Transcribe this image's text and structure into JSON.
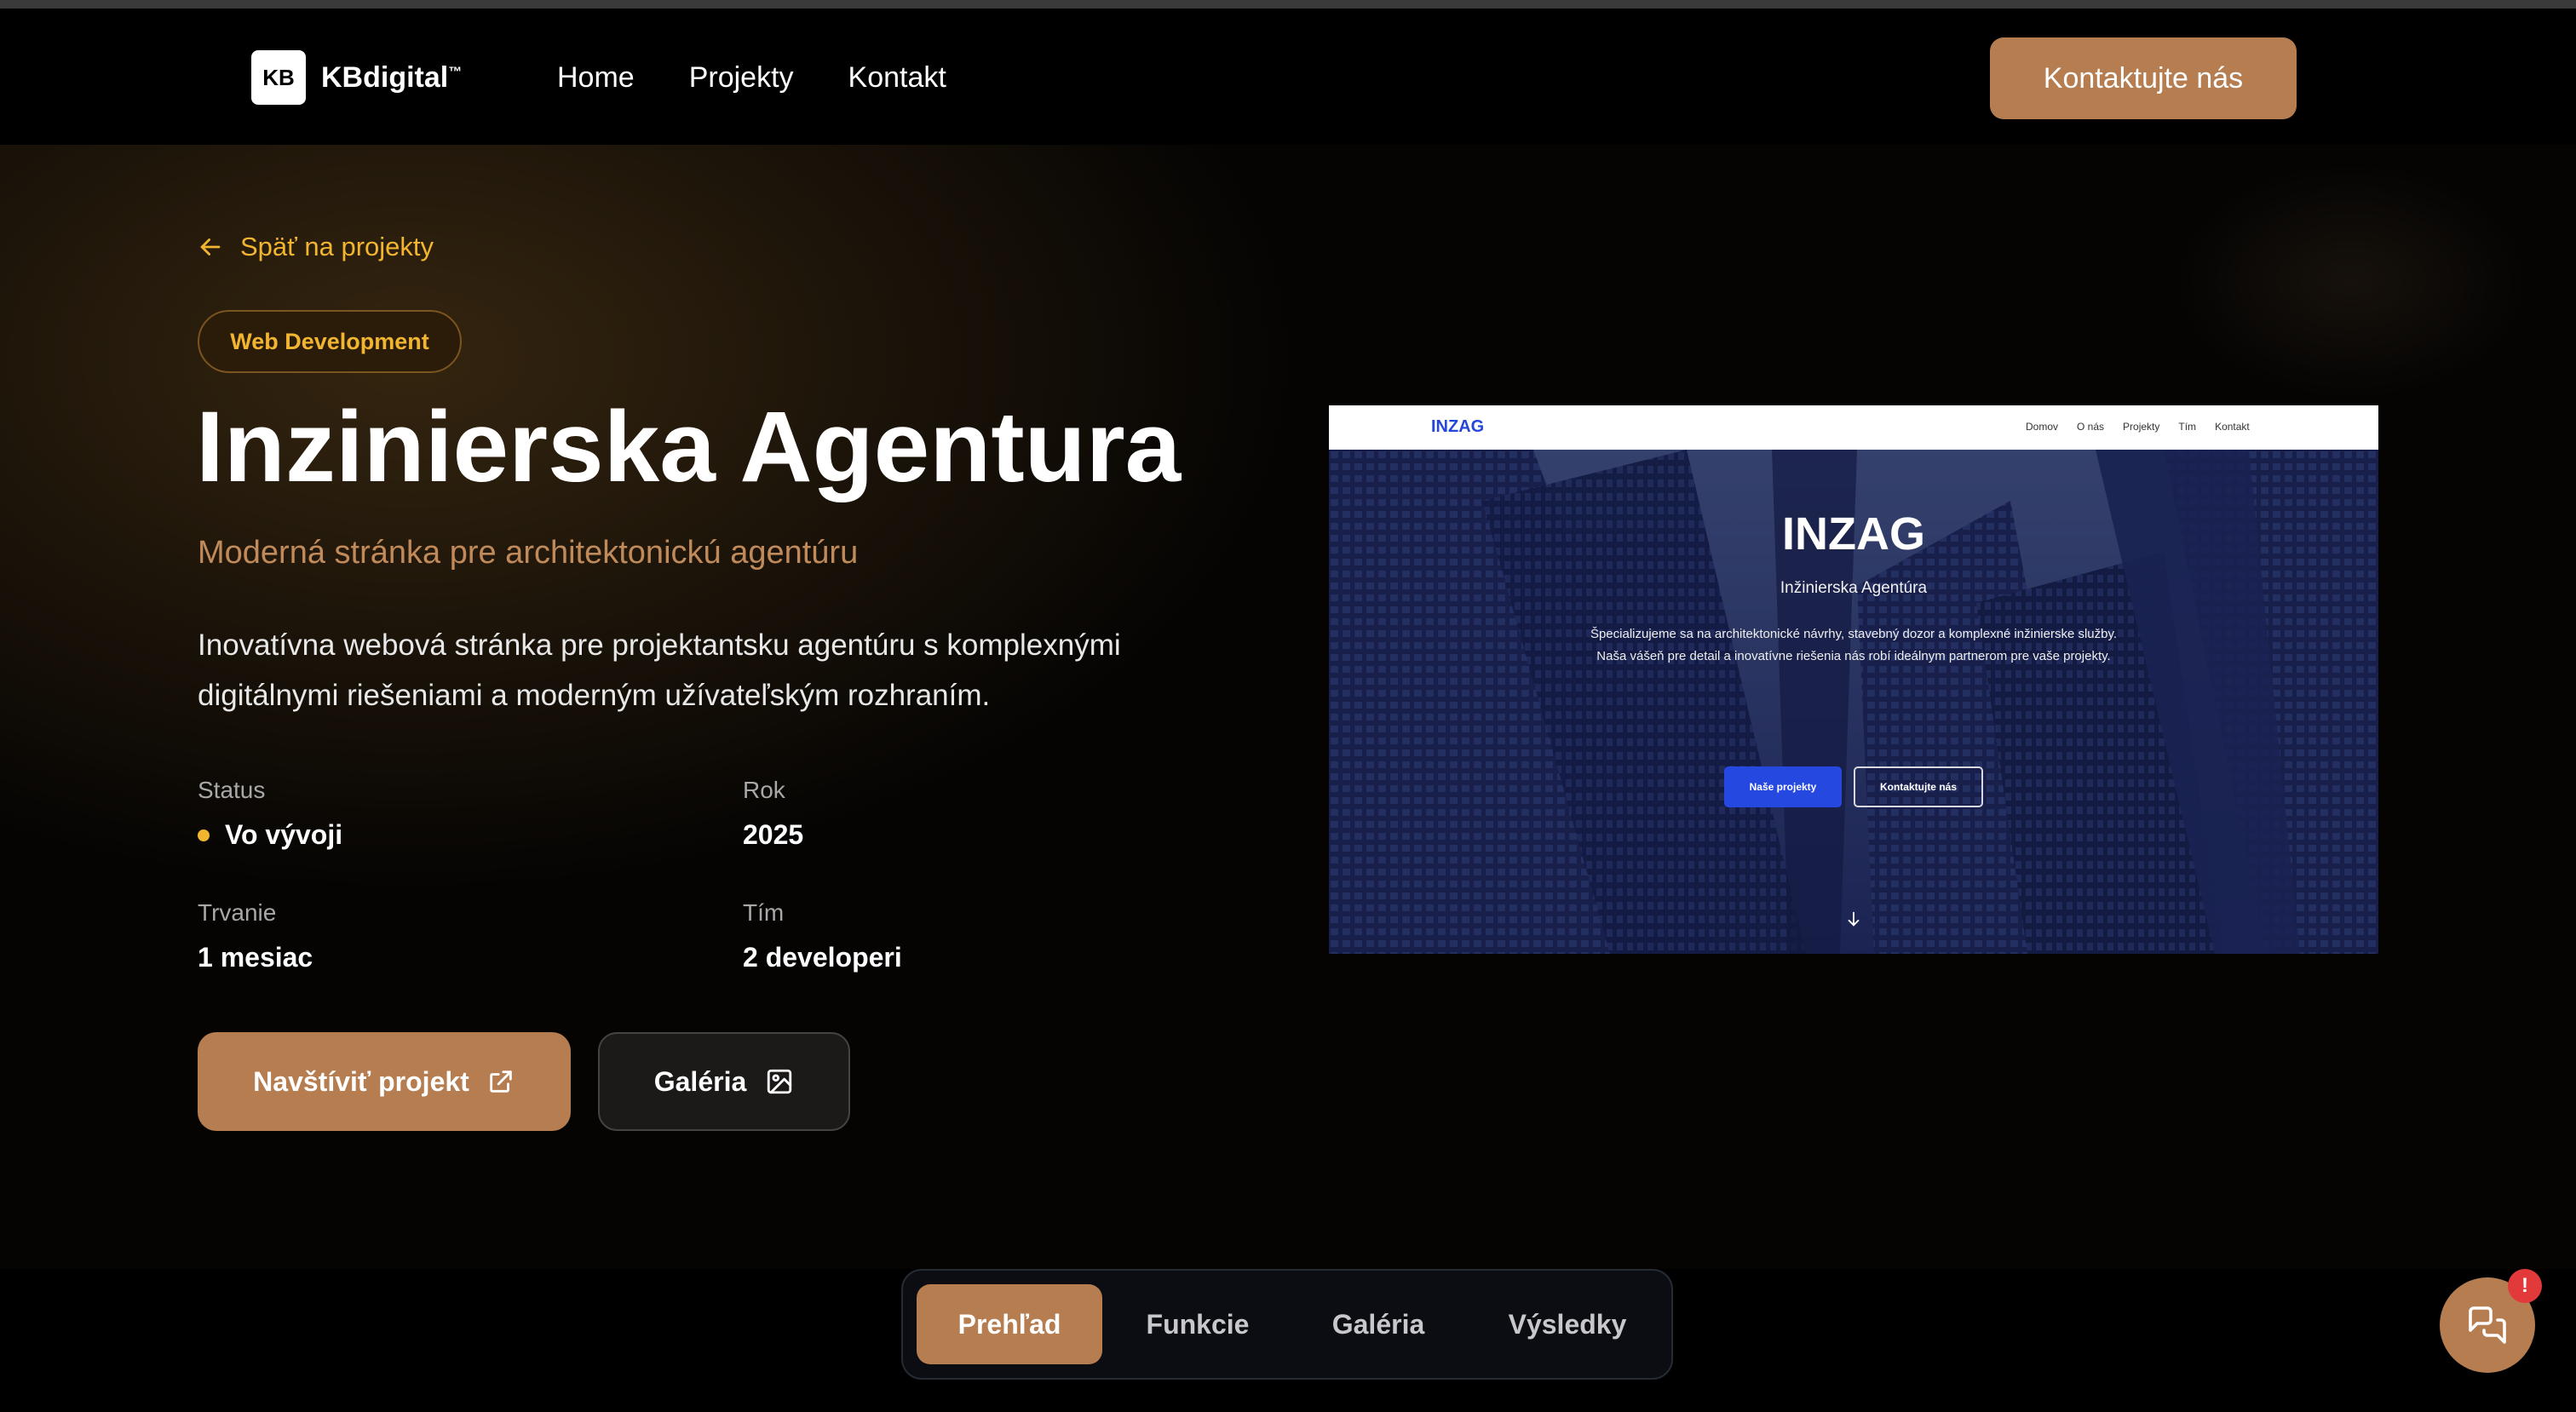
{
  "header": {
    "logo_mark": "KB",
    "logo_text": "KBdigital",
    "logo_tm": "™",
    "nav": [
      {
        "label": "Home"
      },
      {
        "label": "Projekty"
      },
      {
        "label": "Kontakt"
      }
    ],
    "cta_label": "Kontaktujte nás"
  },
  "project": {
    "back_label": "Späť na projekty",
    "category": "Web Development",
    "title": "Inzinierska Agentura",
    "subtitle": "Moderná stránka pre architektonickú agentúru",
    "description": "Inovatívna webová stránka pre projektantsku agentúru s komplexnými digitálnymi riešeniami a moderným užívateľským rozhraním.",
    "meta": {
      "status_label": "Status",
      "status_value": "Vo vývoji",
      "status_color": "#f2b530",
      "year_label": "Rok",
      "year_value": "2025",
      "duration_label": "Trvanie",
      "duration_value": "1 mesiac",
      "team_label": "Tím",
      "team_value": "2 developeri"
    },
    "visit_label": "Navštíviť projekt",
    "gallery_label": "Galéria"
  },
  "preview": {
    "logo": "INZAG",
    "nav": [
      "Domov",
      "O nás",
      "Projekty",
      "Tím",
      "Kontakt"
    ],
    "title": "INZAG",
    "subtitle": "Inžinierska Agentúra",
    "text": "Špecializujeme sa na architektonické návrhy, stavebný dozor a komplexné inžinierske služby. Naša vášeň pre detail a inovatívne riešenia nás robí ideálnym partnerom pre vaše projekty.",
    "btn_primary": "Naše projekty",
    "btn_secondary": "Kontaktujte nás"
  },
  "tabs": [
    {
      "label": "Prehľad",
      "active": true
    },
    {
      "label": "Funkcie",
      "active": false
    },
    {
      "label": "Galéria",
      "active": false
    },
    {
      "label": "Výsledky",
      "active": false
    }
  ],
  "chat": {
    "badge": "!"
  },
  "colors": {
    "accent": "#b57d50",
    "highlight": "#f2b530",
    "background": "#000000"
  }
}
